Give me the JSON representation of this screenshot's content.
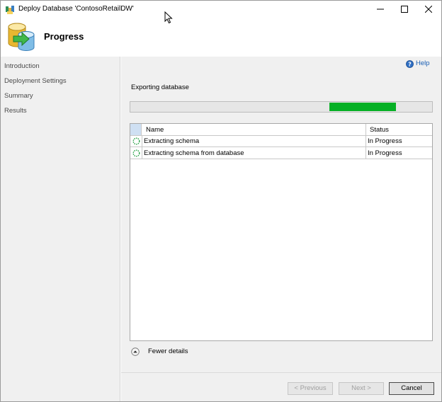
{
  "window": {
    "title": "Deploy Database 'ContosoRetailDW'"
  },
  "header": {
    "title": "Progress"
  },
  "nav": {
    "items": [
      {
        "label": "Introduction"
      },
      {
        "label": "Deployment Settings"
      },
      {
        "label": "Summary"
      },
      {
        "label": "Results"
      }
    ]
  },
  "content": {
    "help_label": "Help",
    "status_label": "Exporting database",
    "progress": {
      "fill_start": 0.66,
      "fill_end": 0.88,
      "color": "#06b025"
    },
    "grid": {
      "columns": [
        "Name",
        "Status"
      ],
      "rows": [
        {
          "name": "Extracting schema",
          "status": "In Progress"
        },
        {
          "name": "Extracting schema from database",
          "status": "In Progress"
        }
      ]
    },
    "details_label": "Fewer details"
  },
  "footer": {
    "previous_label": "< Previous",
    "next_label": "Next >",
    "cancel_label": "Cancel"
  },
  "icons": {
    "title": "database-deploy-icon",
    "header": "database-arrow-icon",
    "help": "help-icon",
    "row": "progress-spinner-icon",
    "details": "collapse-up-icon"
  }
}
